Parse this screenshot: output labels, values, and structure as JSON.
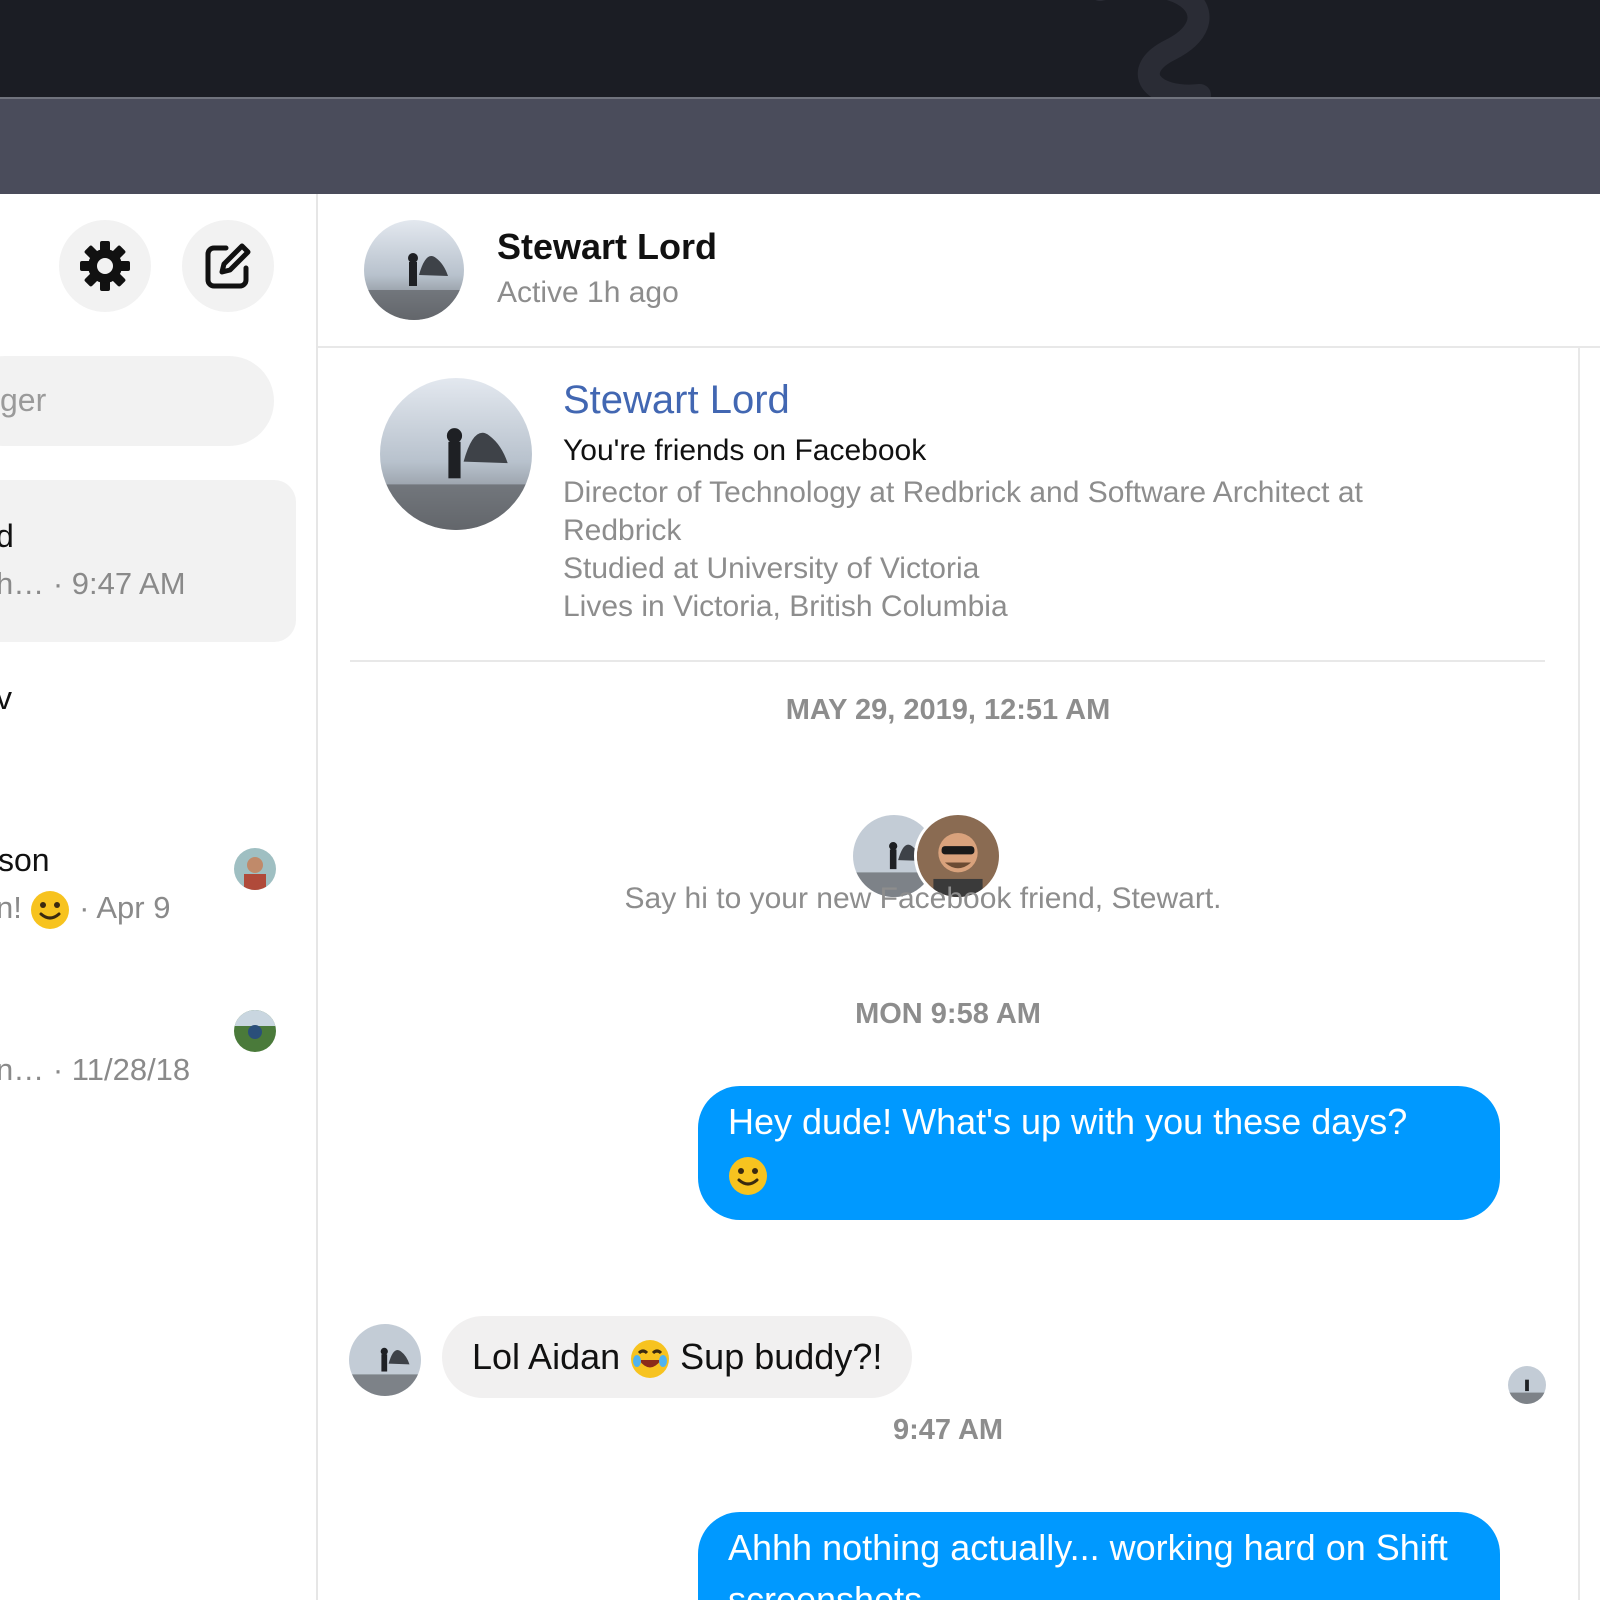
{
  "sidebar": {
    "search_placeholder": "ger",
    "conversations": [
      {
        "name": "d",
        "snippet": "h… · 9:47 AM",
        "active": true
      },
      {
        "name": "v",
        "snippet": ""
      },
      {
        "name": "son",
        "snippet_text": "n!",
        "snippet_time": "· Apr 9"
      },
      {
        "name": "",
        "snippet": "n… · 11/28/18"
      }
    ]
  },
  "header": {
    "contact_name": "Stewart Lord",
    "status": "Active 1h ago"
  },
  "profile": {
    "name": "Stewart Lord",
    "friends_text": "You're friends on Facebook",
    "work": "Director of Technology at Redbrick and Software Architect at Redbrick",
    "education": "Studied at University of Victoria",
    "location": "Lives in Victoria, British Columbia"
  },
  "chat": {
    "timestamp_1": "MAY 29, 2019, 12:51 AM",
    "new_friend_text": "Say hi to your new Facebook friend, Stewart.",
    "timestamp_2": "MON 9:58 AM",
    "msg_1": "Hey dude! What's up with you these days?",
    "msg_2_a": "Lol Aidan",
    "msg_2_b": "Sup buddy?!",
    "timestamp_3": "9:47 AM",
    "msg_3": "Ahhh nothing actually... working hard on Shift screenshots"
  },
  "icons": {
    "settings": "gear-icon",
    "compose": "compose-icon"
  },
  "colors": {
    "outgoing_bubble": "#0099ff",
    "incoming_bubble": "#f1f0f0",
    "profile_link": "#4267b2",
    "topbar": "#1b1d24",
    "toolbar": "#4a4c5b"
  }
}
